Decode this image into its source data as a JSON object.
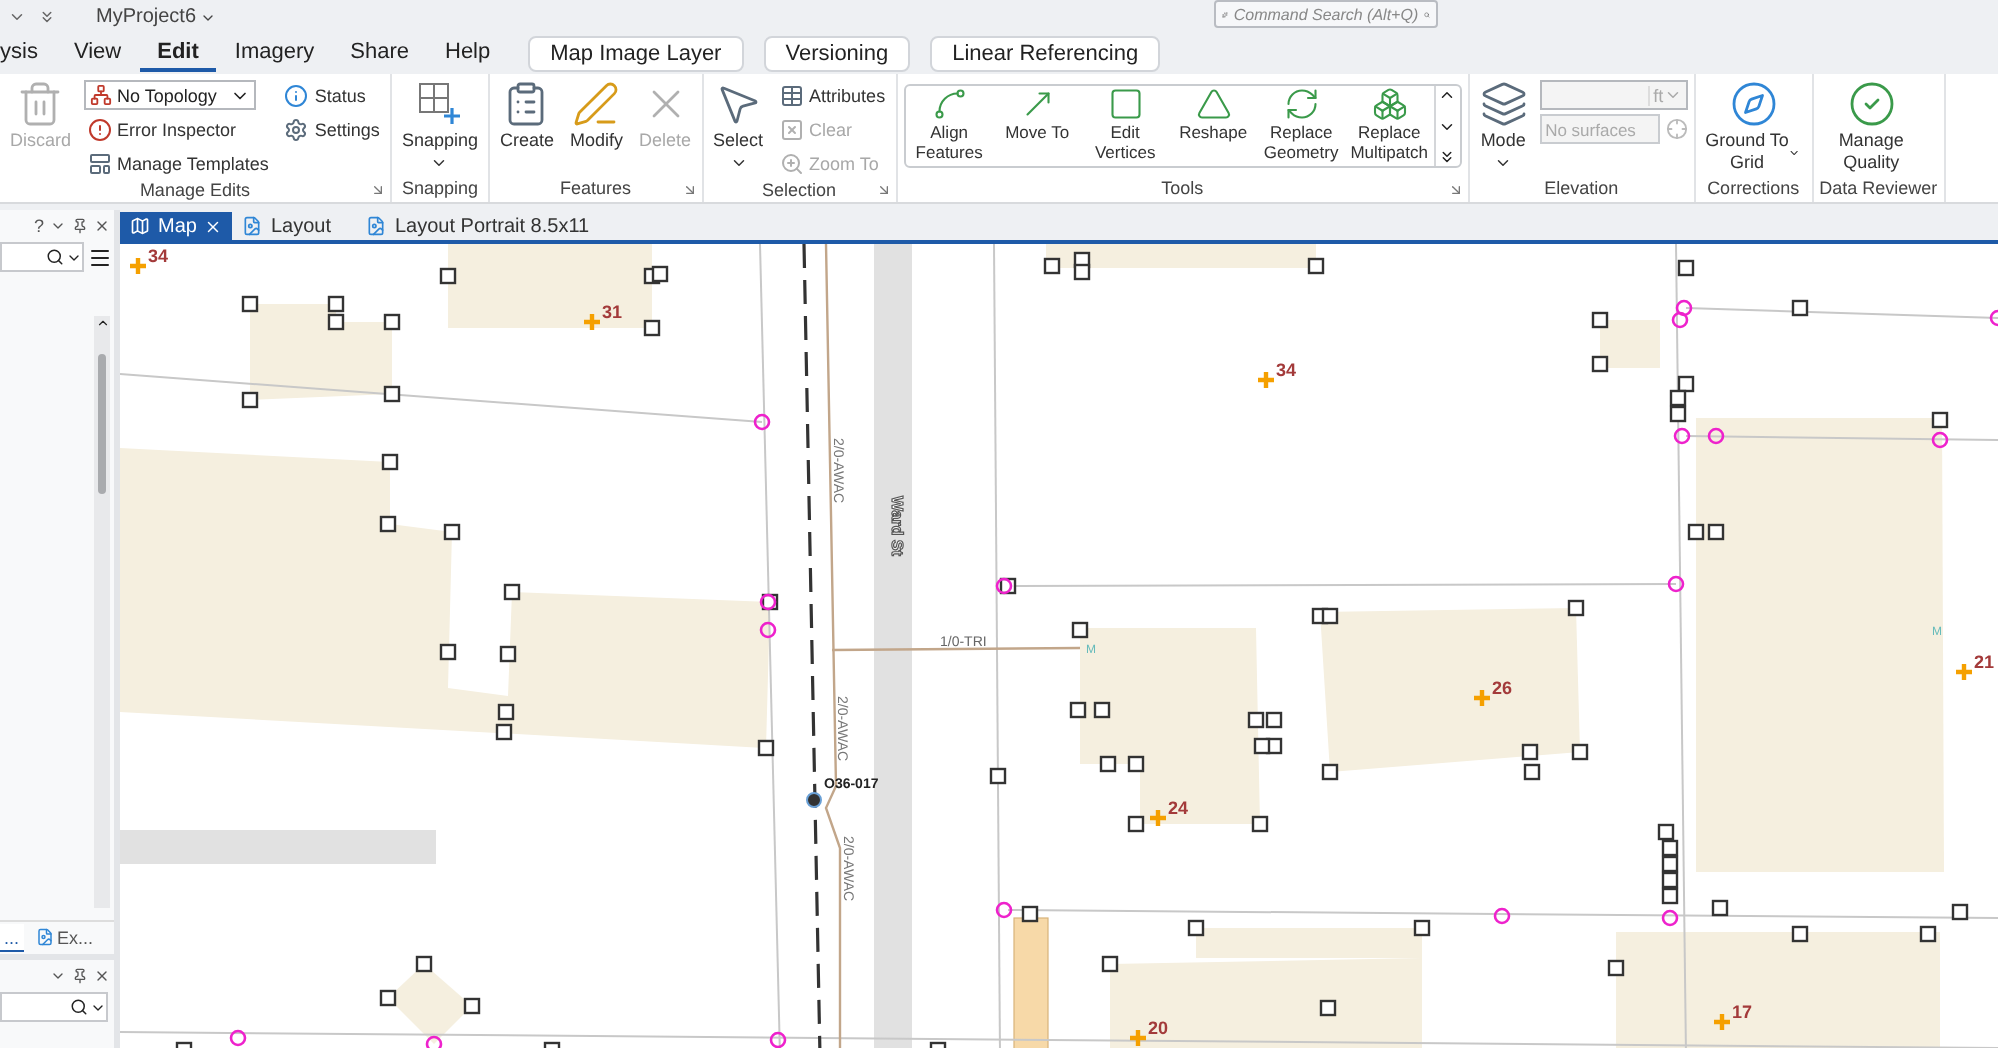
{
  "title_bar": {
    "project": "MyProject6",
    "search_placeholder": "Command Search (Alt+Q)"
  },
  "ribbon_tabs": [
    {
      "label": "ysis",
      "selected": false
    },
    {
      "label": "View",
      "selected": false
    },
    {
      "label": "Edit",
      "selected": true
    },
    {
      "label": "Imagery",
      "selected": false
    },
    {
      "label": "Share",
      "selected": false
    },
    {
      "label": "Help",
      "selected": false
    }
  ],
  "contextual_tabs": [
    "Map Image Layer",
    "Versioning",
    "Linear Referencing"
  ],
  "groups": [
    {
      "label": "Manage Edits",
      "launcher": true,
      "columns": [
        [
          {
            "kind": "large",
            "label": "Discard",
            "disabled": true,
            "menu": false
          }
        ],
        [
          {
            "kind": "combo",
            "label": "No Topology",
            "disabled": false
          },
          {
            "kind": "small",
            "label": "Error Inspector",
            "disabled": false
          },
          {
            "kind": "small",
            "label": "Manage Templates",
            "disabled": false
          }
        ],
        [
          {
            "kind": "small",
            "label": "Status",
            "disabled": false
          },
          {
            "kind": "small",
            "label": "Settings",
            "disabled": false
          }
        ]
      ]
    },
    {
      "label": "Snapping",
      "launcher": false,
      "columns": [
        [
          {
            "kind": "large",
            "label": "Snapping",
            "disabled": false,
            "menu": true
          }
        ]
      ]
    },
    {
      "label": "Features",
      "launcher": true,
      "columns": [
        [
          {
            "kind": "large",
            "label": "Create",
            "disabled": false,
            "menu": false
          }
        ],
        [
          {
            "kind": "large",
            "label": "Modify",
            "disabled": false,
            "menu": false
          }
        ],
        [
          {
            "kind": "large",
            "label": "Delete",
            "disabled": true,
            "menu": false
          }
        ]
      ]
    },
    {
      "label": "Selection",
      "launcher": true,
      "columns": [
        [
          {
            "kind": "large",
            "label": "Select",
            "disabled": false,
            "menu": true
          }
        ],
        [
          {
            "kind": "small",
            "label": "Attributes",
            "disabled": false
          },
          {
            "kind": "small",
            "label": "Clear",
            "disabled": true
          },
          {
            "kind": "small",
            "label": "Zoom To",
            "disabled": true
          }
        ]
      ]
    },
    {
      "label": "Tools",
      "launcher": true,
      "gallery": [
        {
          "label": "Align Features"
        },
        {
          "label": "Move To"
        },
        {
          "label": "Edit Vertices"
        },
        {
          "label": "Reshape"
        },
        {
          "label": "Replace Geometry"
        },
        {
          "label": "Replace Multipatch"
        }
      ]
    },
    {
      "label": "Elevation",
      "launcher": false,
      "columns": [
        [
          {
            "kind": "large",
            "label": "Mode",
            "disabled": false,
            "menu": true
          }
        ],
        [
          {
            "kind": "unit_combo",
            "label": "ft",
            "disabled": true
          },
          {
            "kind": "field",
            "placeholder": "No surfaces",
            "disabled": true
          }
        ]
      ]
    },
    {
      "label": "Corrections",
      "launcher": false,
      "columns": [
        [
          {
            "kind": "large",
            "label": "Ground To Grid",
            "disabled": false,
            "menu": true,
            "inline_menu": true
          }
        ]
      ]
    },
    {
      "label": "Data Reviewer",
      "launcher": false,
      "columns": [
        [
          {
            "kind": "large",
            "label": "Manage Quality",
            "disabled": false,
            "menu": false
          }
        ]
      ]
    }
  ],
  "left_panel": {
    "help_glyph": "?",
    "tabs": [
      {
        "label": "...",
        "selected": true
      },
      {
        "label": "Ex...",
        "selected": false
      }
    ]
  },
  "dock_tabs": [
    {
      "label": "Map",
      "selected": true,
      "closable": true
    },
    {
      "label": "Layout",
      "selected": false,
      "closable": false
    },
    {
      "label": "Layout Portrait 8.5x11",
      "selected": false,
      "closable": false
    }
  ],
  "map": {
    "labels": [
      {
        "kind": "parcel",
        "text": "34"
      },
      {
        "kind": "parcel",
        "text": "31"
      },
      {
        "kind": "parcel",
        "text": "34"
      },
      {
        "kind": "parcel",
        "text": "21"
      },
      {
        "kind": "parcel",
        "text": "26"
      },
      {
        "kind": "parcel",
        "text": "24"
      },
      {
        "kind": "parcel",
        "text": "17"
      },
      {
        "kind": "parcel",
        "text": "20"
      },
      {
        "kind": "conductor",
        "text": "2/0-AWAC"
      },
      {
        "kind": "conductor",
        "text": "2/0-AWAC"
      },
      {
        "kind": "conductor",
        "text": "2/0-AWAC"
      },
      {
        "kind": "street",
        "text": "Ward St"
      },
      {
        "kind": "line",
        "text": "1/0-TRI"
      },
      {
        "kind": "device",
        "text": "O36-017"
      },
      {
        "kind": "meter",
        "text": "M"
      },
      {
        "kind": "meter",
        "text": "M"
      }
    ]
  }
}
